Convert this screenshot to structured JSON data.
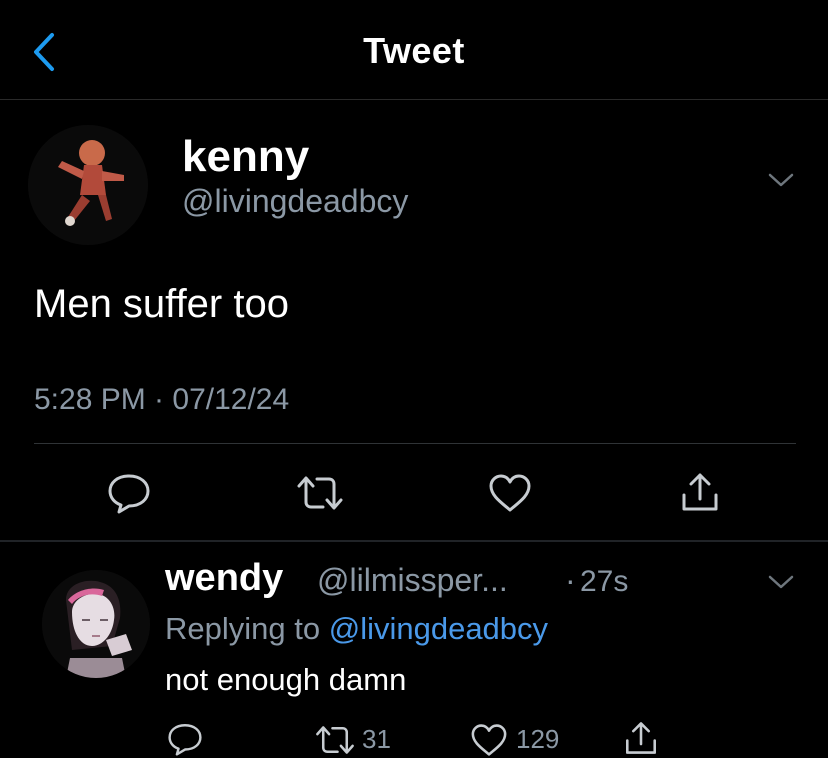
{
  "header": {
    "title": "Tweet",
    "back_icon": "chevron-left-icon"
  },
  "colors": {
    "accent": "#1d9bf0",
    "muted": "#8b98a5",
    "background": "#000000",
    "divider": "#2f3336"
  },
  "tweet": {
    "display_name": "kenny",
    "handle": "@livingdeadbcy",
    "text": "Men suffer too",
    "timestamp": "5:28 PM · 07/12/24",
    "actions": [
      "reply-icon",
      "retweet-icon",
      "like-icon",
      "share-icon"
    ]
  },
  "reply": {
    "display_name": "wendy",
    "handle": "@lilmissper...",
    "separator": "·",
    "time": "27s",
    "replying_prefix": "Replying to ",
    "replying_to": "@livingdeadbcy",
    "text": "not enough damn",
    "retweet_count": "31",
    "like_count": "129"
  }
}
